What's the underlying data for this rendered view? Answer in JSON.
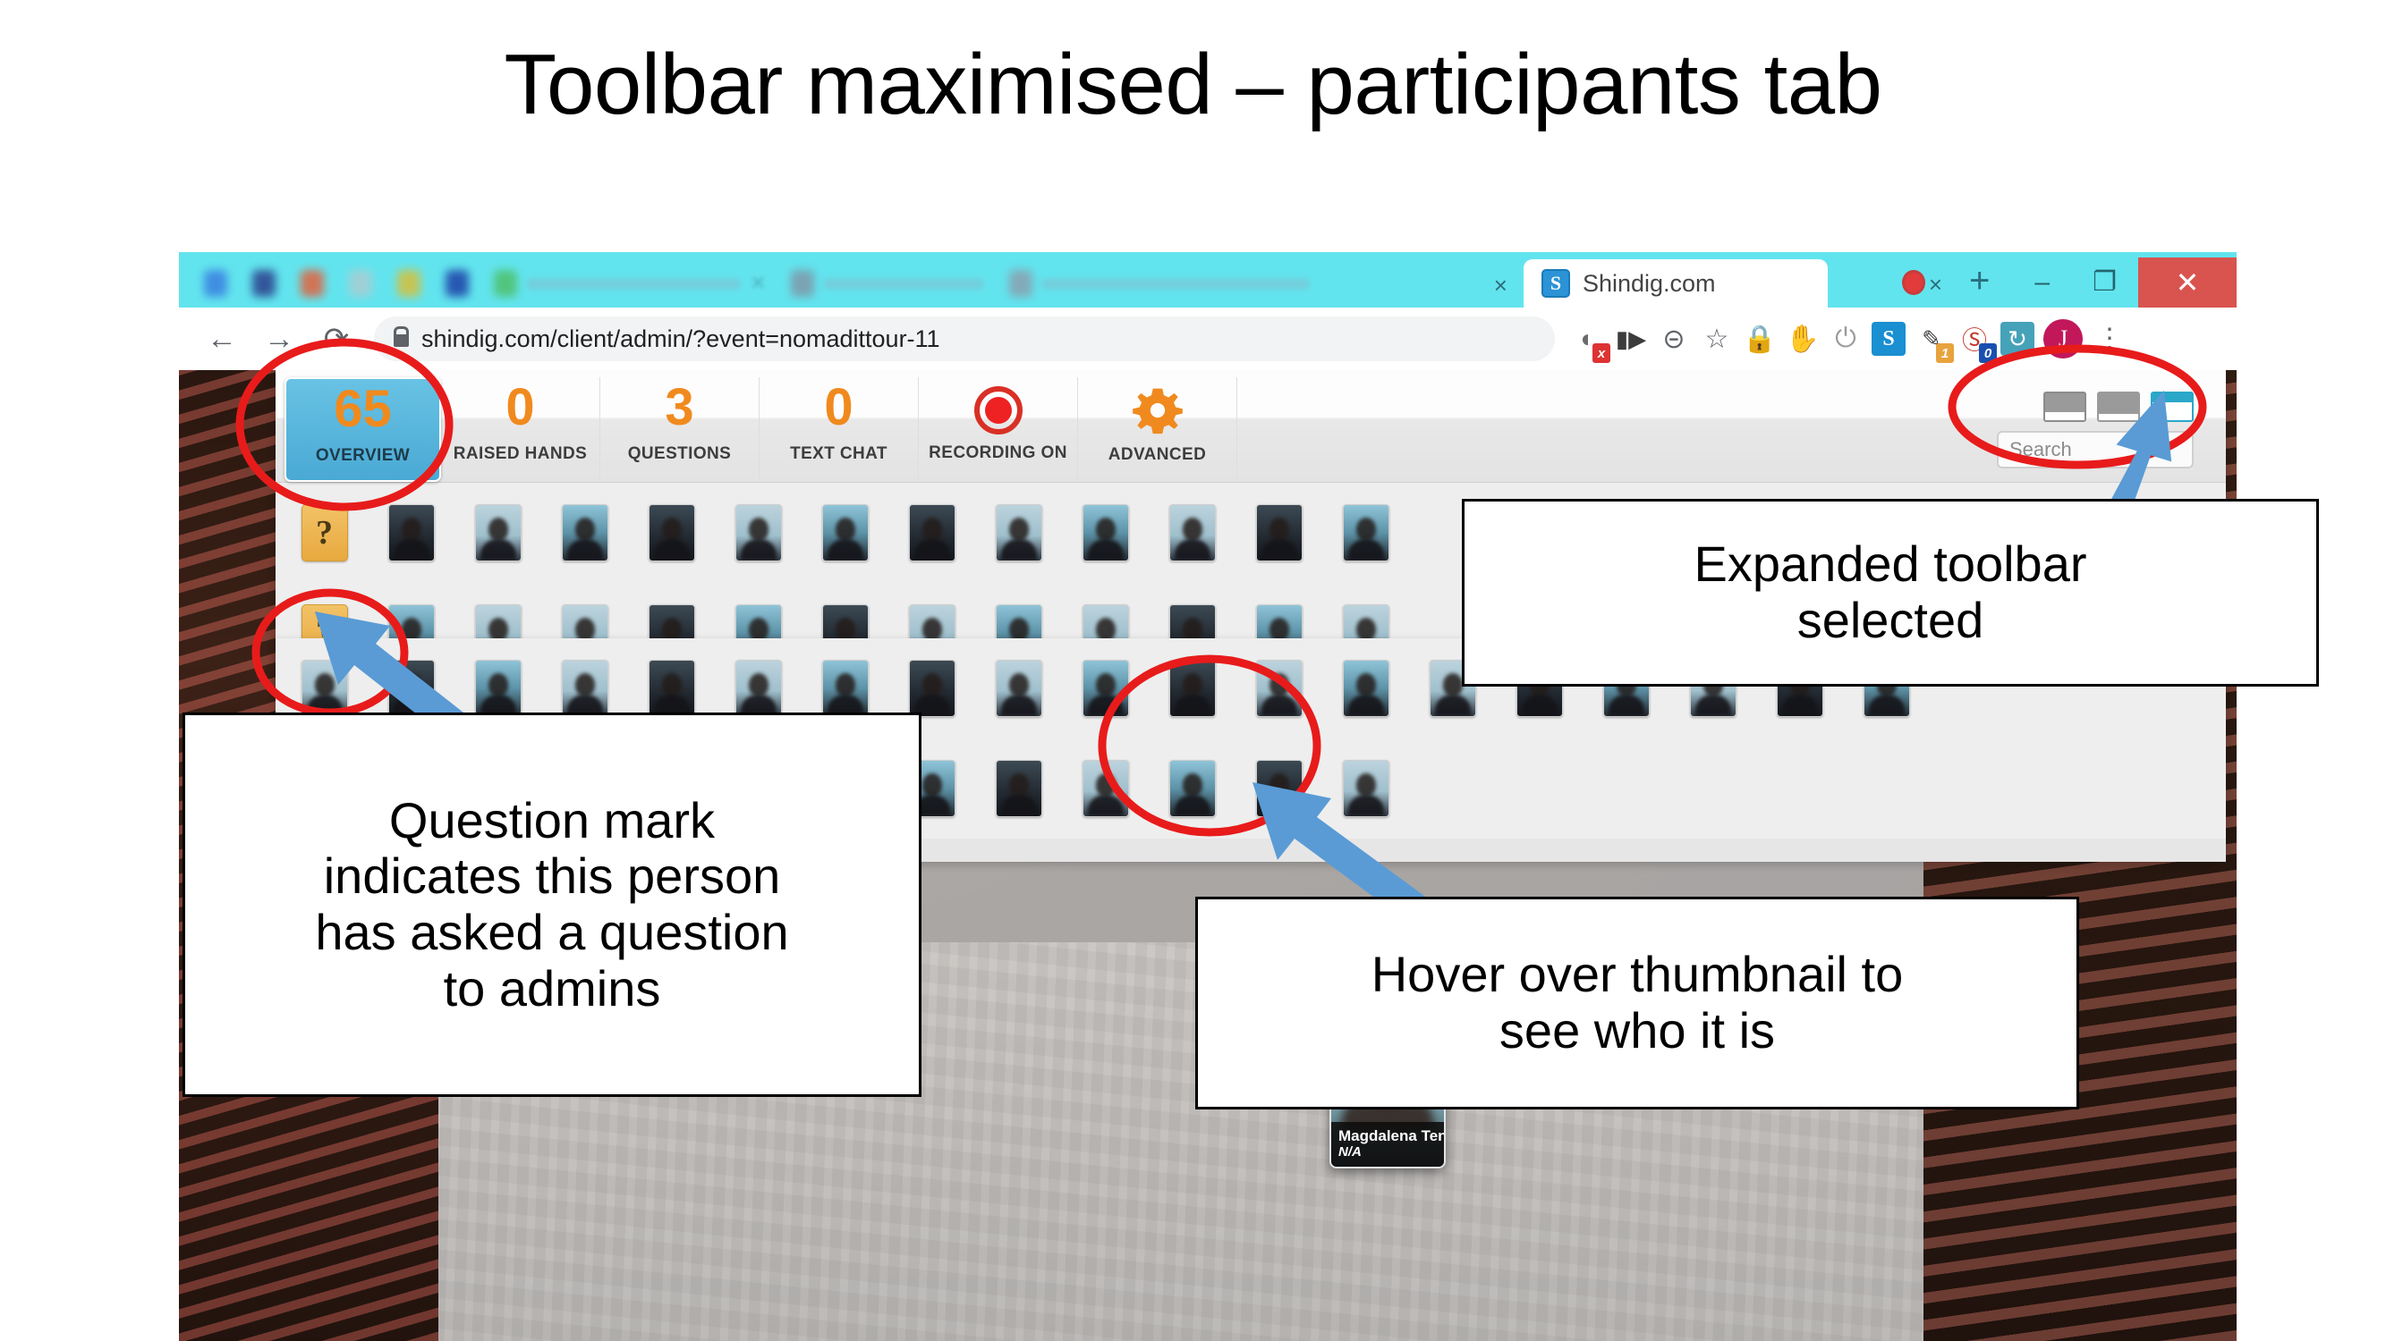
{
  "slide": {
    "title": "Toolbar maximised – participants tab"
  },
  "browser": {
    "tabs": {
      "active_tab_title": "Shindig.com",
      "favicon_letter": "S",
      "close_label": "×",
      "new_tab_label": "+",
      "recording_indicator": "recording-dot"
    },
    "window_controls": {
      "minimize": "–",
      "restore": "❐",
      "close": "✕"
    },
    "omnibox": {
      "back": "←",
      "forward": "→",
      "reload": "⟳",
      "url": "shindig.com/client/admin/?event=nomadittour-11",
      "lock_icon": "lock-icon"
    },
    "extensions": [
      {
        "name": "cookie-blocker-icon",
        "glyph": "◕",
        "color": "#6b6b6b",
        "badge": "x",
        "badge_color": "#d33"
      },
      {
        "name": "screen-recorder-icon",
        "glyph": "▶",
        "color": "#3c3c3c",
        "badge": "",
        "badge_color": ""
      },
      {
        "name": "zoom-out-icon",
        "glyph": "⊝",
        "color": "#5f6368",
        "badge": "",
        "badge_color": ""
      },
      {
        "name": "bookmark-star-icon",
        "glyph": "☆",
        "color": "#5f6368",
        "badge": "",
        "badge_color": ""
      },
      {
        "name": "password-manager-icon",
        "glyph": "ὑ2",
        "color": "#1e2d5a",
        "badge": "",
        "badge_color": ""
      },
      {
        "name": "adblock-stop-icon",
        "glyph": "✋",
        "color": "#d8232a",
        "badge": "",
        "badge_color": ""
      },
      {
        "name": "power-toggle-icon",
        "glyph": "⏻",
        "color": "#9a9a9a",
        "badge": "",
        "badge_color": ""
      },
      {
        "name": "shindig-extension-icon",
        "glyph": "S",
        "color": "#1a8fd1",
        "badge": "",
        "badge_color": ""
      },
      {
        "name": "highlighter-pen-icon",
        "glyph": "✒",
        "color": "#3d3d3d",
        "badge": "1",
        "badge_color": "#e8a33d"
      },
      {
        "name": "grammar-check-icon",
        "glyph": "ⓖ",
        "color": "#c0392b",
        "badge": "0",
        "badge_color": "#1a4fb0"
      },
      {
        "name": "sync-icon",
        "glyph": "↻",
        "color": "#46a2b8",
        "badge": "",
        "badge_color": ""
      }
    ],
    "profile_initial": "J",
    "menu_icon": "kebab-menu-icon"
  },
  "shindig": {
    "toolbar_tabs": [
      {
        "name": "overview",
        "value": "65",
        "label": "OVERVIEW",
        "selected": true,
        "icon": ""
      },
      {
        "name": "raised-hands",
        "value": "0",
        "label": "RAISED HANDS",
        "selected": false,
        "icon": ""
      },
      {
        "name": "questions",
        "value": "3",
        "label": "QUESTIONS",
        "selected": false,
        "icon": ""
      },
      {
        "name": "text-chat",
        "value": "0",
        "label": "TEXT CHAT",
        "selected": false,
        "icon": ""
      },
      {
        "name": "recording",
        "value": "",
        "label": "RECORDING ON",
        "selected": false,
        "icon": "record-dot-icon"
      },
      {
        "name": "advanced",
        "value": "",
        "label": "ADVANCED",
        "selected": false,
        "icon": "gear-icon"
      }
    ],
    "view_toggles": [
      {
        "name": "minimised-toolbar",
        "selected": false
      },
      {
        "name": "split-toolbar",
        "selected": false
      },
      {
        "name": "expanded-toolbar",
        "selected": true
      }
    ],
    "search": {
      "placeholder": "Search",
      "value": ""
    },
    "hover_card": {
      "name": "Magdalena Tend",
      "subtitle": "N/A"
    },
    "participant_rows": [
      {
        "question_mark": true,
        "question_mark_label": "?",
        "count": 13
      },
      {
        "question_mark": true,
        "question_mark_label": "?",
        "count": 13
      },
      {
        "question_mark": false,
        "question_mark_label": "",
        "count": 19
      },
      {
        "question_mark": false,
        "question_mark_label": "",
        "count": 13
      }
    ]
  },
  "annotations": {
    "expanded_toolbar": "Expanded toolbar\nselected",
    "expanded_toolbar_line1": "Expanded toolbar",
    "expanded_toolbar_line2": "selected",
    "question_mark_line1": "Question mark",
    "question_mark_line2": "indicates this person",
    "question_mark_line3": "has asked a question",
    "question_mark_line4": "to admins",
    "hover_line1": "Hover over thumbnail to",
    "hover_line2": "see who it is"
  },
  "colors": {
    "accent_orange": "#f08a1e",
    "selected_blue": "#4aa9d4",
    "tabstrip_cyan": "#62e4ee",
    "annotation_red": "#e81b1b",
    "arrow_blue": "#5a9bd5",
    "question_gold": "#e8a93f",
    "close_red": "#d9534f"
  }
}
